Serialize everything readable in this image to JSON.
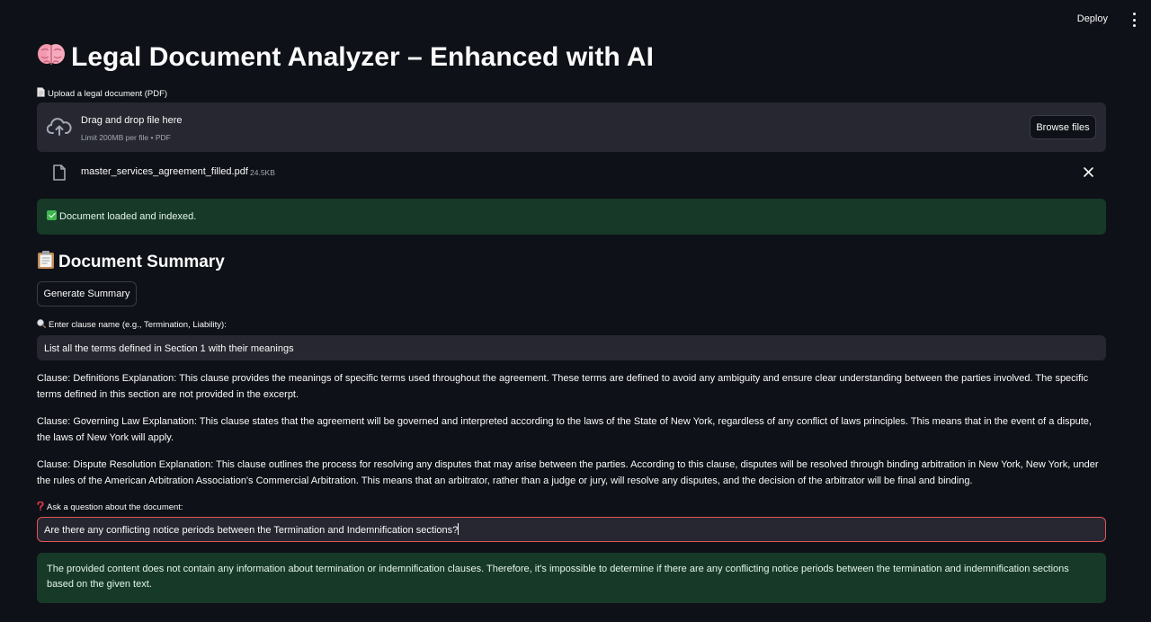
{
  "header": {
    "deploy_label": "Deploy",
    "menu_icon": "kebab-menu-icon"
  },
  "title": {
    "emoji": "brain-icon",
    "text": "Legal Document Analyzer – Enhanced with AI"
  },
  "upload": {
    "label_icon": "page-icon",
    "label": "Upload a legal document (PDF)",
    "drop_title": "Drag and drop file here",
    "drop_subtitle": "Limit 200MB per file • PDF",
    "browse_label": "Browse files",
    "file": {
      "name": "master_services_agreement_filled.pdf",
      "size": "24.5KB"
    }
  },
  "status": {
    "loaded_message": "Document loaded and indexed.",
    "color": "#173928"
  },
  "summary": {
    "heading": "Document Summary",
    "generate_label": "Generate Summary"
  },
  "clause_search": {
    "label": "Enter clause name (e.g., Termination, Liability):",
    "value": "List all the terms defined in Section 1 with their meanings"
  },
  "clauses": [
    "Clause: Definitions Explanation: This clause provides the meanings of specific terms used throughout the agreement. These terms are defined to avoid any ambiguity and ensure clear understanding between the parties involved. The specific terms defined in this section are not provided in the excerpt.",
    "Clause: Governing Law Explanation: This clause states that the agreement will be governed and interpreted according to the laws of the State of New York, regardless of any conflict of laws principles. This means that in the event of a dispute, the laws of New York will apply.",
    "Clause: Dispute Resolution Explanation: This clause outlines the process for resolving any disputes that may arise between the parties. According to this clause, disputes will be resolved through binding arbitration in New York, New York, under the rules of the American Arbitration Association's Commercial Arbitration. This means that an arbitrator, rather than a judge or jury, will resolve any disputes, and the decision of the arbitrator will be final and binding."
  ],
  "question": {
    "label": "Ask a question about the document:",
    "value": "Are there any conflicting notice periods between the Termination and Indemnification sections?",
    "answer": "The provided content does not contain any information about termination or indemnification clauses. Therefore, it's impossible to determine if there are any conflicting notice periods between the termination and indemnification sections based on the given text."
  },
  "colors": {
    "background": "#0e1117",
    "input_bg": "#262730",
    "focus_border": "#e3545a",
    "success_bg": "#173928"
  }
}
